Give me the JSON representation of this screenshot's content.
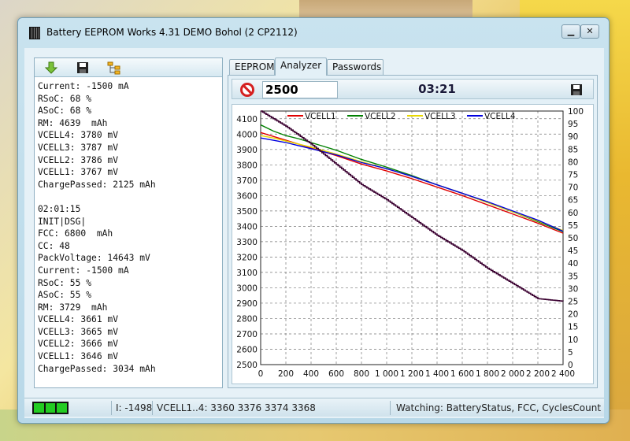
{
  "window": {
    "title": "Battery EEPROM Works  4.31 DEMO Bohol (2 CP2112)"
  },
  "log_lines": [
    "Current: -1500 mA",
    "RSoC: 68 %",
    "ASoC: 68 %",
    "RM: 4639  mAh",
    "VCELL4: 3780 mV",
    "VCELL3: 3787 mV",
    "VCELL2: 3786 mV",
    "VCELL1: 3767 mV",
    "ChargePassed: 2125 mAh",
    "",
    "02:01:15",
    "INIT|DSG|",
    "FCC: 6800  mAh",
    "CC: 48",
    "PackVoltage: 14643 mV",
    "Current: -1500 mA",
    "RSoC: 55 %",
    "ASoC: 55 %",
    "RM: 3729  mAh",
    "VCELL4: 3661 mV",
    "VCELL3: 3665 mV",
    "VCELL2: 3666 mV",
    "VCELL1: 3646 mV",
    "ChargePassed: 3034 mAh"
  ],
  "tabs": [
    {
      "label": "EEPROM",
      "active": false
    },
    {
      "label": "Analyzer",
      "active": true
    },
    {
      "label": "Passwords",
      "active": false
    }
  ],
  "analyzer": {
    "value": "2500",
    "timer": "03:21"
  },
  "status": {
    "current": "I: -1498",
    "vcells": "VCELL1..4: 3360 3376 3374 3368",
    "watching": "Watching: BatteryStatus, FCC, CyclesCount"
  },
  "chart_data": {
    "type": "line",
    "title": "",
    "xlabel": "",
    "ylabel": "",
    "xlim": [
      0,
      2400
    ],
    "ylim": [
      2500,
      4150
    ],
    "y2lim": [
      0,
      100
    ],
    "x_ticks": [
      "0",
      "200",
      "400",
      "600",
      "800",
      "1 000",
      "1 200",
      "1 400",
      "1 600",
      "1 800",
      "2 000",
      "2 200",
      "2 400"
    ],
    "y_ticks": [
      2500,
      2600,
      2700,
      2800,
      2900,
      3000,
      3100,
      3200,
      3300,
      3400,
      3500,
      3600,
      3700,
      3800,
      3900,
      4000,
      4100
    ],
    "y2_ticks": [
      0,
      5,
      10,
      15,
      20,
      25,
      30,
      35,
      40,
      45,
      50,
      55,
      60,
      65,
      70,
      75,
      80,
      85,
      90,
      95,
      100
    ],
    "grid": true,
    "legend_position": "top",
    "series": [
      {
        "name": "VCELL1",
        "color": "#e00000",
        "axis": "left",
        "x": [
          0,
          100,
          200,
          300,
          400,
          600,
          800,
          1000,
          1200,
          1400,
          1600,
          1800,
          2000,
          2200,
          2400
        ],
        "y": [
          4010,
          3985,
          3960,
          3935,
          3910,
          3860,
          3805,
          3760,
          3710,
          3655,
          3600,
          3540,
          3480,
          3420,
          3355
        ]
      },
      {
        "name": "VCELL2",
        "color": "#008000",
        "axis": "left",
        "x": [
          0,
          100,
          200,
          300,
          400,
          600,
          800,
          1000,
          1200,
          1400,
          1600,
          1800,
          2000,
          2200,
          2400
        ],
        "y": [
          4060,
          4020,
          3990,
          3970,
          3945,
          3895,
          3835,
          3785,
          3730,
          3670,
          3615,
          3555,
          3495,
          3430,
          3365
        ]
      },
      {
        "name": "VCELL3",
        "color": "#e8d800",
        "axis": "left",
        "x": [
          0,
          100,
          200,
          300,
          400,
          600,
          800,
          1000,
          1200,
          1400,
          1600,
          1800,
          2000,
          2200,
          2400
        ],
        "y": [
          3990,
          3975,
          3955,
          3935,
          3915,
          3870,
          3820,
          3775,
          3725,
          3670,
          3615,
          3555,
          3495,
          3435,
          3372
        ]
      },
      {
        "name": "VCELL4",
        "color": "#0000e0",
        "axis": "left",
        "x": [
          0,
          100,
          200,
          300,
          400,
          600,
          800,
          1000,
          1200,
          1400,
          1600,
          1800,
          2000,
          2200,
          2400
        ],
        "y": [
          3975,
          3960,
          3945,
          3925,
          3905,
          3865,
          3815,
          3775,
          3725,
          3670,
          3615,
          3560,
          3500,
          3440,
          3368
        ]
      },
      {
        "name": "",
        "color": "#3a0030",
        "axis": "right",
        "x": [
          0,
          200,
          400,
          600,
          800,
          1000,
          1200,
          1400,
          1600,
          1800,
          2000,
          2200,
          2400
        ],
        "y": [
          100,
          94,
          87,
          79,
          71,
          65,
          58,
          51,
          45,
          38,
          32,
          26,
          25
        ]
      }
    ]
  }
}
